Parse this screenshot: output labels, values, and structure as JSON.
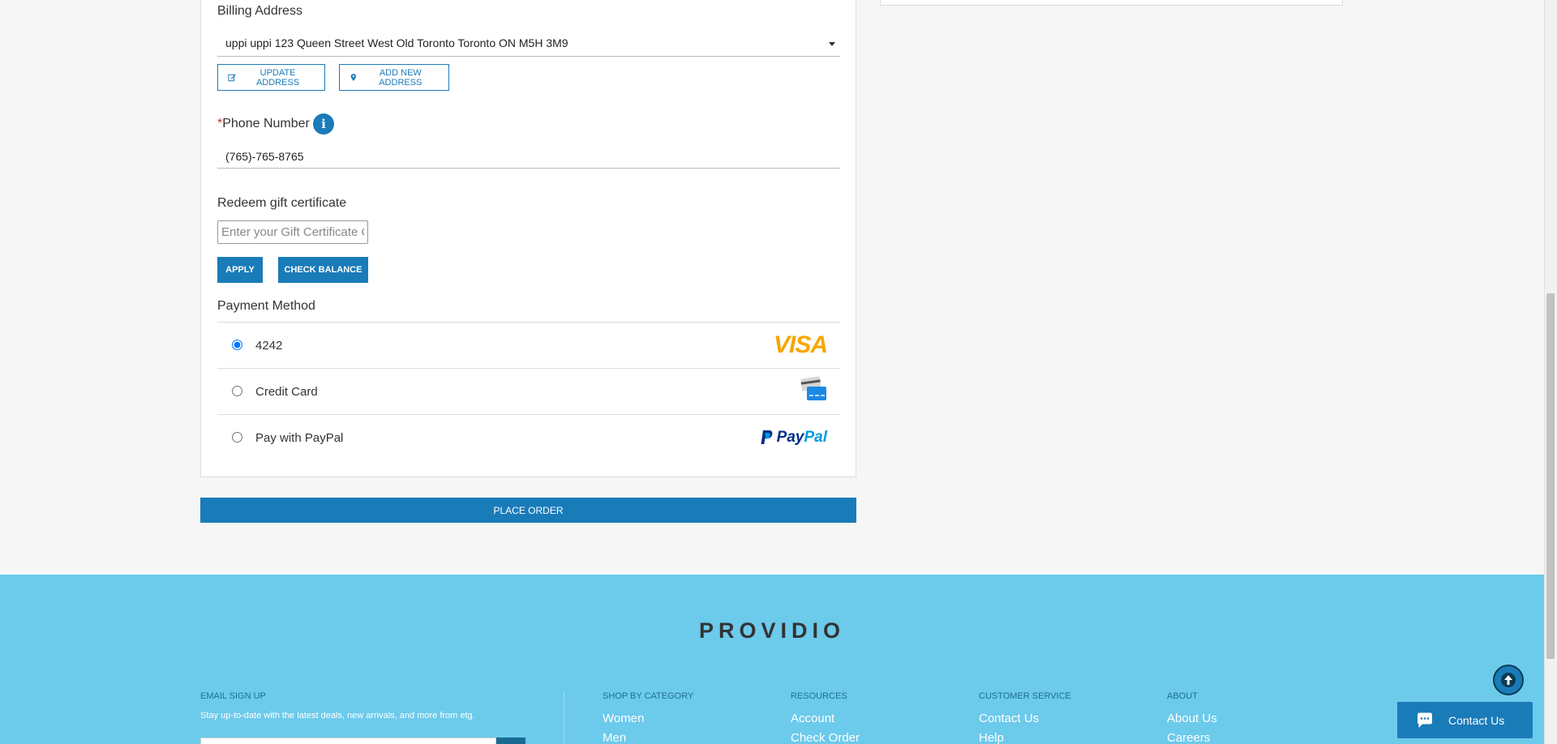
{
  "billing": {
    "label": "Billing Address",
    "selected_address": "uppi uppi 123 Queen Street West Old Toronto Toronto ON M5H 3M9",
    "update_label": "UPDATE ADDRESS",
    "add_label": "ADD NEW ADDRESS"
  },
  "phone": {
    "required_mark": "*",
    "label": "Phone Number",
    "value": "(765)-765-8765",
    "info_glyph": "i"
  },
  "gift": {
    "label": "Redeem gift certificate",
    "placeholder": "Enter your Gift Certificate Code",
    "apply_label": "APPLY",
    "check_label": "CHECK BALANCE"
  },
  "payment": {
    "label": "Payment Method",
    "options": [
      {
        "label": "4242",
        "selected": true,
        "logo": "visa-logo",
        "logo_text": "VISA"
      },
      {
        "label": "Credit Card",
        "selected": false,
        "logo": "credit-card-icon"
      },
      {
        "label": "Pay with PayPal",
        "selected": false,
        "logo": "paypal-logo",
        "logo_text_1": "Pay",
        "logo_text_2": "Pal"
      }
    ]
  },
  "place_order_label": "PLACE ORDER",
  "footer": {
    "brand": "PROVIDIO",
    "email_signup": {
      "heading": "EMAIL SIGN UP",
      "text": "Stay up-to-date with the latest deals, new arrivals, and more from etg."
    },
    "columns": [
      {
        "heading": "SHOP BY CATEGORY",
        "links": [
          "Women",
          "Men"
        ]
      },
      {
        "heading": "RESOURCES",
        "links": [
          "Account",
          "Check Order"
        ]
      },
      {
        "heading": "CUSTOMER SERVICE",
        "links": [
          "Contact Us",
          "Help"
        ]
      },
      {
        "heading": "ABOUT",
        "links": [
          "About Us",
          "Careers"
        ]
      }
    ]
  },
  "chat": {
    "label": "Contact Us"
  },
  "colors": {
    "accent": "#1a7bb9",
    "footer_bg": "#6ccaeb",
    "page_bg": "#f6f6f6"
  }
}
